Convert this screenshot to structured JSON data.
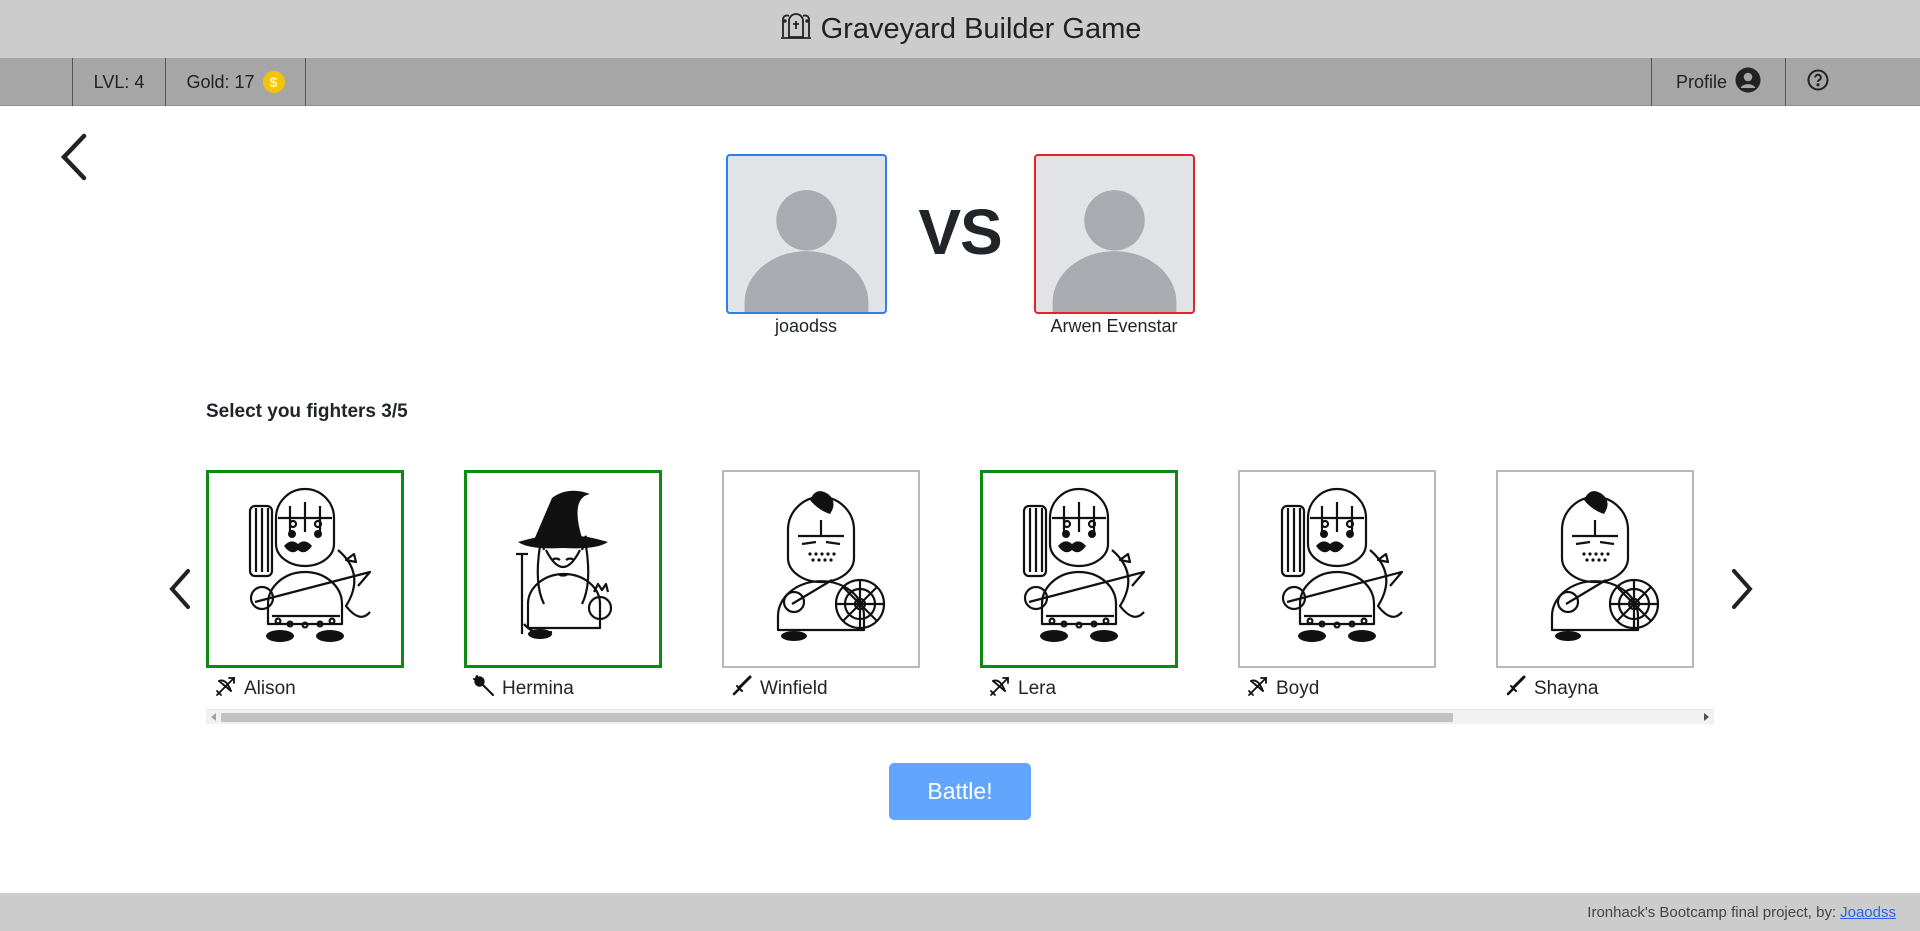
{
  "header": {
    "title": "Graveyard Builder Game",
    "logo_icon": "tombstone-ghost-icon"
  },
  "nav": {
    "level": "LVL: 4",
    "gold": "Gold: 17",
    "coin_symbol": "$",
    "profile": "Profile",
    "profile_icon": "user-circle-icon",
    "help_icon": "help-circle-icon"
  },
  "battle": {
    "player": {
      "name": "joaodss",
      "accent": "#2f7fe8"
    },
    "opponent": {
      "name": "Arwen Evenstar",
      "accent": "#e0242e"
    },
    "vs": "VS"
  },
  "fighters": {
    "title": "Select you fighters 3/5",
    "items": [
      {
        "name": "Alison",
        "class_icon": "bow-icon",
        "portrait": "archer",
        "selected": true
      },
      {
        "name": "Hermina",
        "class_icon": "staff-icon",
        "portrait": "mage",
        "selected": true
      },
      {
        "name": "Winfield",
        "class_icon": "sword-icon",
        "portrait": "knight",
        "selected": false
      },
      {
        "name": "Lera",
        "class_icon": "bow-icon",
        "portrait": "archer",
        "selected": true
      },
      {
        "name": "Boyd",
        "class_icon": "bow-icon",
        "portrait": "archer",
        "selected": false
      },
      {
        "name": "Shayna",
        "class_icon": "sword-icon",
        "portrait": "knight",
        "selected": false
      }
    ],
    "selected_color": "#0c8a12"
  },
  "actions": {
    "battle": "Battle!"
  },
  "footer": {
    "text": "Ironhack's Bootcamp final project, by:",
    "link": "Joaodss"
  }
}
